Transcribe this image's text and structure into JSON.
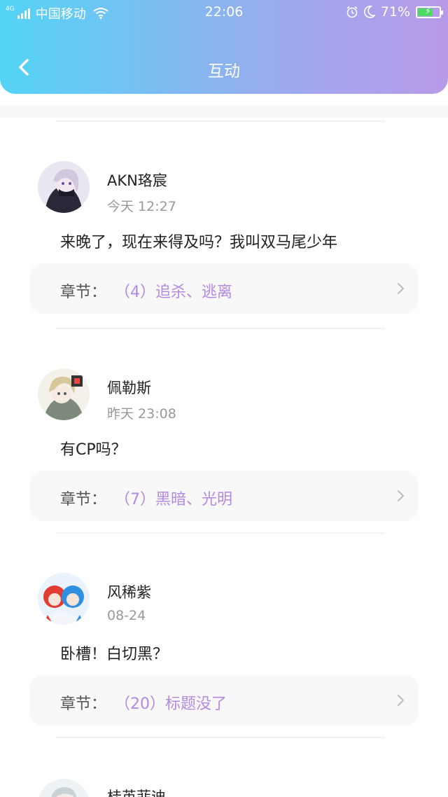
{
  "status_bar": {
    "network": "4G",
    "carrier": "中国移动",
    "time": "22:06",
    "battery": "71%",
    "battery_level": 0.71
  },
  "nav": {
    "title": "互动"
  },
  "comments": [
    {
      "user": "AKN珞宸",
      "time": "今天 12:27",
      "content": "来晚了，现在来得及吗？我叫双马尾少年",
      "chapter_label": "章节：",
      "chapter_title": "（4）追杀、逃离"
    },
    {
      "user": "佩勒斯",
      "time": "昨天 23:08",
      "content": "有CP吗？",
      "chapter_label": "章节：",
      "chapter_title": "（7）黑暗、光明"
    },
    {
      "user": "风稀紫",
      "time": "08-24",
      "content": "卧槽！白切黑？",
      "chapter_label": "章节：",
      "chapter_title": "（20）标题没了"
    },
    {
      "user": "桂英菲迪",
      "time": "",
      "content": "",
      "chapter_label": "",
      "chapter_title": ""
    }
  ]
}
